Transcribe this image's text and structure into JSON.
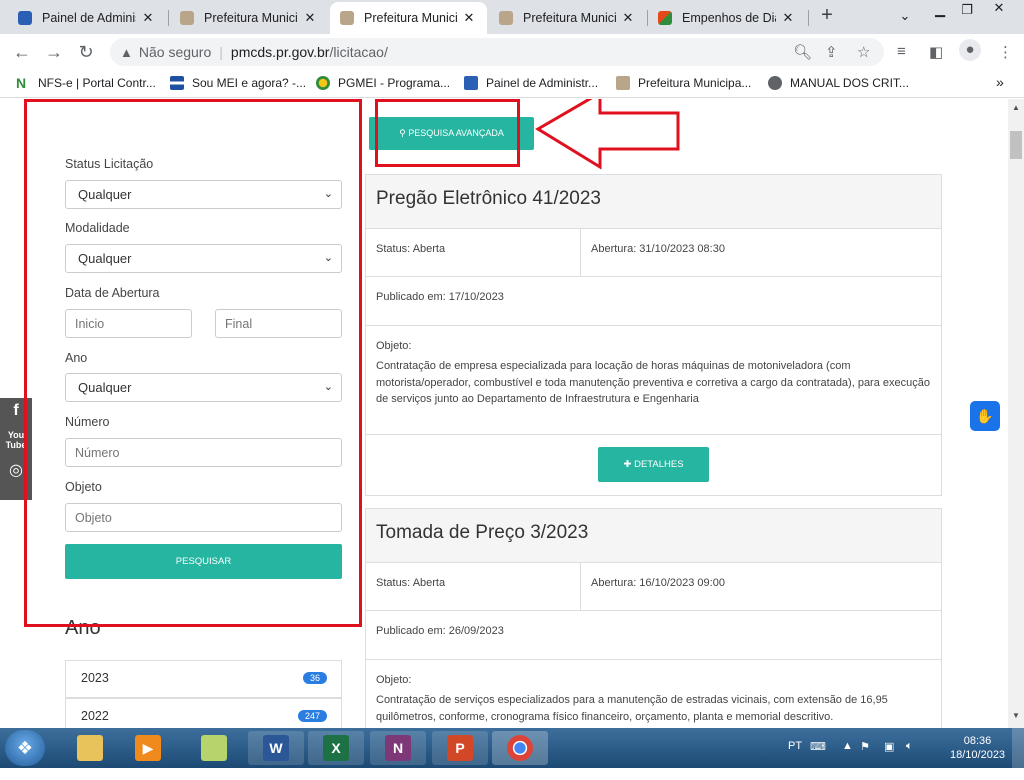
{
  "browser": {
    "tabs": [
      {
        "title": "Painel de Adminis",
        "active": false
      },
      {
        "title": "Prefeitura Municip",
        "active": false
      },
      {
        "title": "Prefeitura Municip",
        "active": true
      },
      {
        "title": "Prefeitura Municip",
        "active": false
      },
      {
        "title": "Empenhos de Diá",
        "active": false
      }
    ],
    "new_tab": "+",
    "url_warning": "Não seguro",
    "url_host": "pmcds.pr.gov.br",
    "url_path": "/licitacao/",
    "bookmarks": [
      {
        "label": "NFS-e | Portal Contr..."
      },
      {
        "label": "Sou MEI e agora? -..."
      },
      {
        "label": "PGMEI - Programa..."
      },
      {
        "label": "Painel de Administr..."
      },
      {
        "label": "Prefeitura Municipa..."
      },
      {
        "label": "MANUAL DOS CRIT..."
      }
    ],
    "bookmarks_more": "»"
  },
  "filters": {
    "status_label": "Status Licitação",
    "status_value": "Qualquer",
    "modalidade_label": "Modalidade",
    "modalidade_value": "Qualquer",
    "data_label": "Data de Abertura",
    "data_inicio_placeholder": "Inicio",
    "data_final_placeholder": "Final",
    "ano_label": "Ano",
    "ano_value": "Qualquer",
    "numero_label": "Número",
    "numero_placeholder": "Número",
    "objeto_label": "Objeto",
    "objeto_placeholder": "Objeto",
    "search_button": "PESQUISAR"
  },
  "advanced_search_button": "PESQUISA AVANÇADA",
  "cards": [
    {
      "title": "Pregão Eletrônico 41/2023",
      "status": "Status: Aberta",
      "abertura": "Abertura: 31/10/2023 08:30",
      "publicado": "Publicado em: 17/10/2023",
      "objeto_label": "Objeto:",
      "objeto": "Contratação de empresa especializada para locação de horas máquinas de motoniveladora (com motorista/operador, combustível e toda manutenção preventiva e corretiva a cargo da contratada), para execução de serviços junto ao Departamento de Infraestrutura e Engenharia",
      "details_button": "DETALHES"
    },
    {
      "title": "Tomada de Preço 3/2023",
      "status": "Status: Aberta",
      "abertura": "Abertura: 16/10/2023 09:00",
      "publicado": "Publicado em: 26/09/2023",
      "objeto_label": "Objeto:",
      "objeto": "Contratação de serviços especializados para a manutenção de estradas vicinais, com extensão de 16,95 quilômetros, conforme, cronograma físico financeiro, orçamento, planta e memorial descritivo."
    }
  ],
  "year_section": {
    "heading": "Ano",
    "items": [
      {
        "year": "2023",
        "count": "36"
      },
      {
        "year": "2022",
        "count": "247"
      }
    ]
  },
  "taskbar": {
    "language": "PT",
    "time": "08:36",
    "date": "18/10/2023"
  },
  "colors": {
    "accent_teal": "#26b5a0",
    "annotation_red": "#e0101e",
    "badge_blue": "#2a7de1"
  }
}
